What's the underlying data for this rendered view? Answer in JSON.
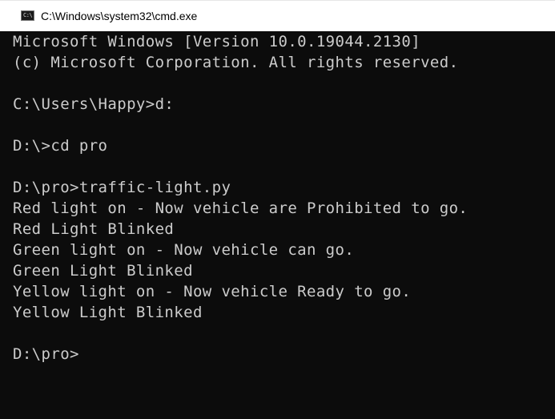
{
  "window": {
    "title": "C:\\Windows\\system32\\cmd.exe",
    "icon": "cmd-console-icon",
    "icon_glyph": "C:\\"
  },
  "console": {
    "background": "#0c0c0c",
    "foreground": "#cccccc",
    "lines": [
      "Microsoft Windows [Version 10.0.19044.2130]",
      "(c) Microsoft Corporation. All rights reserved.",
      "",
      "C:\\Users\\Happy>d:",
      "",
      "D:\\>cd pro",
      "",
      "D:\\pro>traffic-light.py",
      "Red light on - Now vehicle are Prohibited to go.",
      "Red Light Blinked",
      "Green light on - Now vehicle can go.",
      "Green Light Blinked",
      "Yellow light on - Now vehicle Ready to go.",
      "Yellow Light Blinked",
      "",
      "D:\\pro>"
    ]
  }
}
